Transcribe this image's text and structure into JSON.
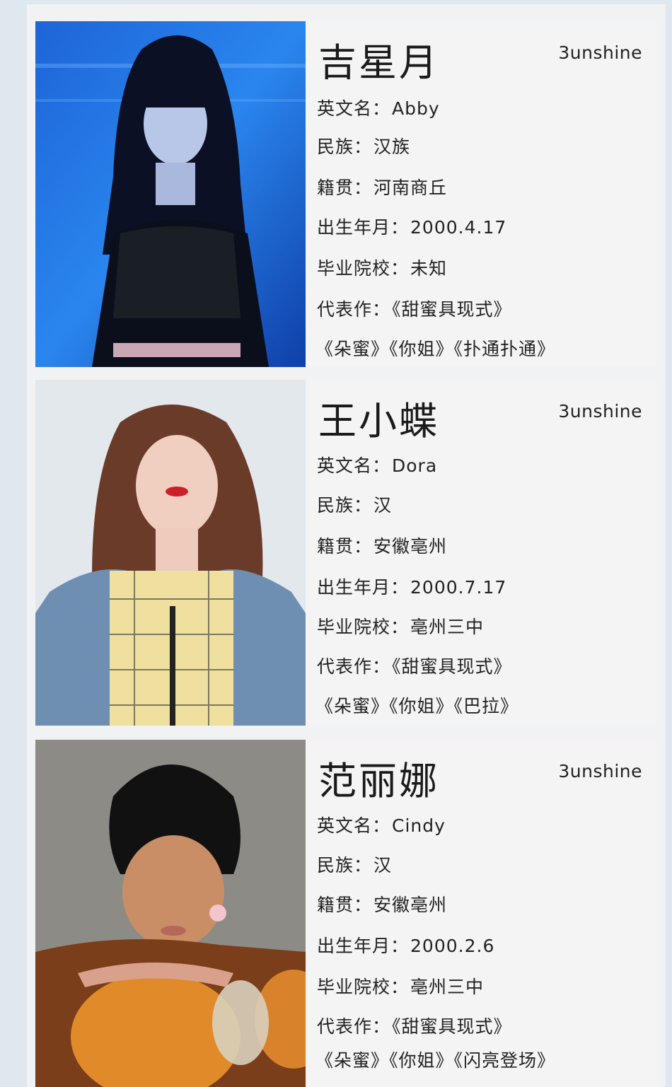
{
  "members": [
    {
      "name": "吉星月",
      "brand": "3unshine",
      "english_name_label": "英文名：",
      "english_name": "Abby",
      "ethnicity_label": "民族：",
      "ethnicity": "汉族",
      "hometown_label": "籍贯：",
      "hometown": "河南商丘",
      "birth_label": "出生年月：",
      "birth": "2000.4.17",
      "school_label": "毕业院校：",
      "school": "未知",
      "works_label": "代表作：",
      "works_first": "《甜蜜具现式》",
      "works_line2": "《朵蜜》《你姐》《扑通扑通》",
      "photo_bg": "#1f6fd6"
    },
    {
      "name": "王小蝶",
      "brand": "3unshine",
      "english_name_label": "英文名：",
      "english_name": "Dora",
      "ethnicity_label": "民族：",
      "ethnicity": "汉",
      "hometown_label": "籍贯：",
      "hometown": "安徽亳州",
      "birth_label": "出生年月：",
      "birth": "2000.7.17",
      "school_label": "毕业院校：",
      "school": "亳州三中",
      "works_label": "代表作：",
      "works_first": "《甜蜜具现式》",
      "works_line2": "《朵蜜》《你姐》《巴拉》",
      "photo_bg": "#e4e8ec"
    },
    {
      "name": "范丽娜",
      "brand": "3unshine",
      "english_name_label": "英文名：",
      "english_name": "Cindy",
      "ethnicity_label": "民族：",
      "ethnicity": "汉",
      "hometown_label": "籍贯：",
      "hometown": "安徽亳州",
      "birth_label": "出生年月：",
      "birth": "2000.2.6",
      "school_label": "毕业院校：",
      "school": "亳州三中",
      "works_label": "代表作：",
      "works_first": "《甜蜜具现式》",
      "works_line2": "《朵蜜》《你姐》《闪亮登场》",
      "photo_bg": "#8b8a85"
    }
  ]
}
